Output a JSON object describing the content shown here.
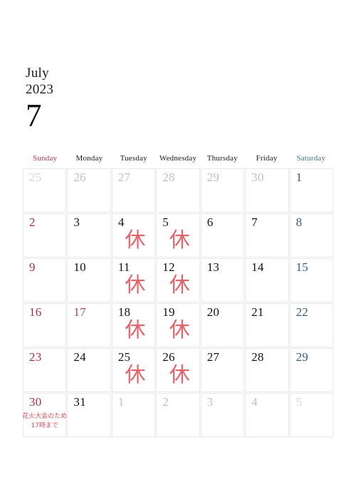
{
  "header": {
    "month_name": "July",
    "year": "2023",
    "month_number": "7"
  },
  "weekdays": [
    {
      "label": "Sunday",
      "kind": "sun"
    },
    {
      "label": "Monday",
      "kind": "weekday"
    },
    {
      "label": "Tuesday",
      "kind": "weekday"
    },
    {
      "label": "Wednesday",
      "kind": "weekday"
    },
    {
      "label": "Thursday",
      "kind": "weekday"
    },
    {
      "label": "Friday",
      "kind": "weekday"
    },
    {
      "label": "Saturday",
      "kind": "sat"
    }
  ],
  "colors": {
    "sunday_red": "#a8313f",
    "saturday_blue": "#2f5f86",
    "holiday_red": "#b2434f",
    "closed_mark_red": "#e2636a",
    "note_red": "#d2545e",
    "outside_month_gray": "#bfbfbf",
    "cell_border": "#e9e9ea",
    "text_black": "#121212"
  },
  "closed_mark_label": "休",
  "weeks": [
    [
      {
        "day": "25",
        "style": "out-sun",
        "in_month": false
      },
      {
        "day": "26",
        "style": "out",
        "in_month": false
      },
      {
        "day": "27",
        "style": "out",
        "in_month": false
      },
      {
        "day": "28",
        "style": "out",
        "in_month": false
      },
      {
        "day": "29",
        "style": "out",
        "in_month": false
      },
      {
        "day": "30",
        "style": "out",
        "in_month": false
      },
      {
        "day": "1",
        "style": "sat",
        "in_month": true
      }
    ],
    [
      {
        "day": "2",
        "style": "sun",
        "in_month": true
      },
      {
        "day": "3",
        "style": "weekday",
        "in_month": true
      },
      {
        "day": "4",
        "style": "weekday",
        "in_month": true,
        "closed": true
      },
      {
        "day": "5",
        "style": "weekday",
        "in_month": true,
        "closed": true
      },
      {
        "day": "6",
        "style": "weekday",
        "in_month": true
      },
      {
        "day": "7",
        "style": "weekday",
        "in_month": true
      },
      {
        "day": "8",
        "style": "sat",
        "in_month": true
      }
    ],
    [
      {
        "day": "9",
        "style": "sun",
        "in_month": true
      },
      {
        "day": "10",
        "style": "weekday",
        "in_month": true
      },
      {
        "day": "11",
        "style": "weekday",
        "in_month": true,
        "closed": true
      },
      {
        "day": "12",
        "style": "weekday",
        "in_month": true,
        "closed": true
      },
      {
        "day": "13",
        "style": "weekday",
        "in_month": true
      },
      {
        "day": "14",
        "style": "weekday",
        "in_month": true
      },
      {
        "day": "15",
        "style": "sat",
        "in_month": true
      }
    ],
    [
      {
        "day": "16",
        "style": "sun",
        "in_month": true
      },
      {
        "day": "17",
        "style": "holiday",
        "in_month": true
      },
      {
        "day": "18",
        "style": "weekday",
        "in_month": true,
        "closed": true
      },
      {
        "day": "19",
        "style": "weekday",
        "in_month": true,
        "closed": true
      },
      {
        "day": "20",
        "style": "weekday",
        "in_month": true
      },
      {
        "day": "21",
        "style": "weekday",
        "in_month": true
      },
      {
        "day": "22",
        "style": "sat",
        "in_month": true
      }
    ],
    [
      {
        "day": "23",
        "style": "sun",
        "in_month": true
      },
      {
        "day": "24",
        "style": "weekday",
        "in_month": true
      },
      {
        "day": "25",
        "style": "weekday",
        "in_month": true,
        "closed": true
      },
      {
        "day": "26",
        "style": "weekday",
        "in_month": true,
        "closed": true
      },
      {
        "day": "27",
        "style": "weekday",
        "in_month": true
      },
      {
        "day": "28",
        "style": "weekday",
        "in_month": true
      },
      {
        "day": "29",
        "style": "sat",
        "in_month": true
      }
    ],
    [
      {
        "day": "30",
        "style": "sun",
        "in_month": true,
        "note": [
          "花火大会のため",
          "17時まで"
        ]
      },
      {
        "day": "31",
        "style": "weekday",
        "in_month": true
      },
      {
        "day": "1",
        "style": "out",
        "in_month": false
      },
      {
        "day": "2",
        "style": "out",
        "in_month": false
      },
      {
        "day": "3",
        "style": "out",
        "in_month": false
      },
      {
        "day": "4",
        "style": "out",
        "in_month": false
      },
      {
        "day": "5",
        "style": "out-sat",
        "in_month": false
      }
    ]
  ]
}
